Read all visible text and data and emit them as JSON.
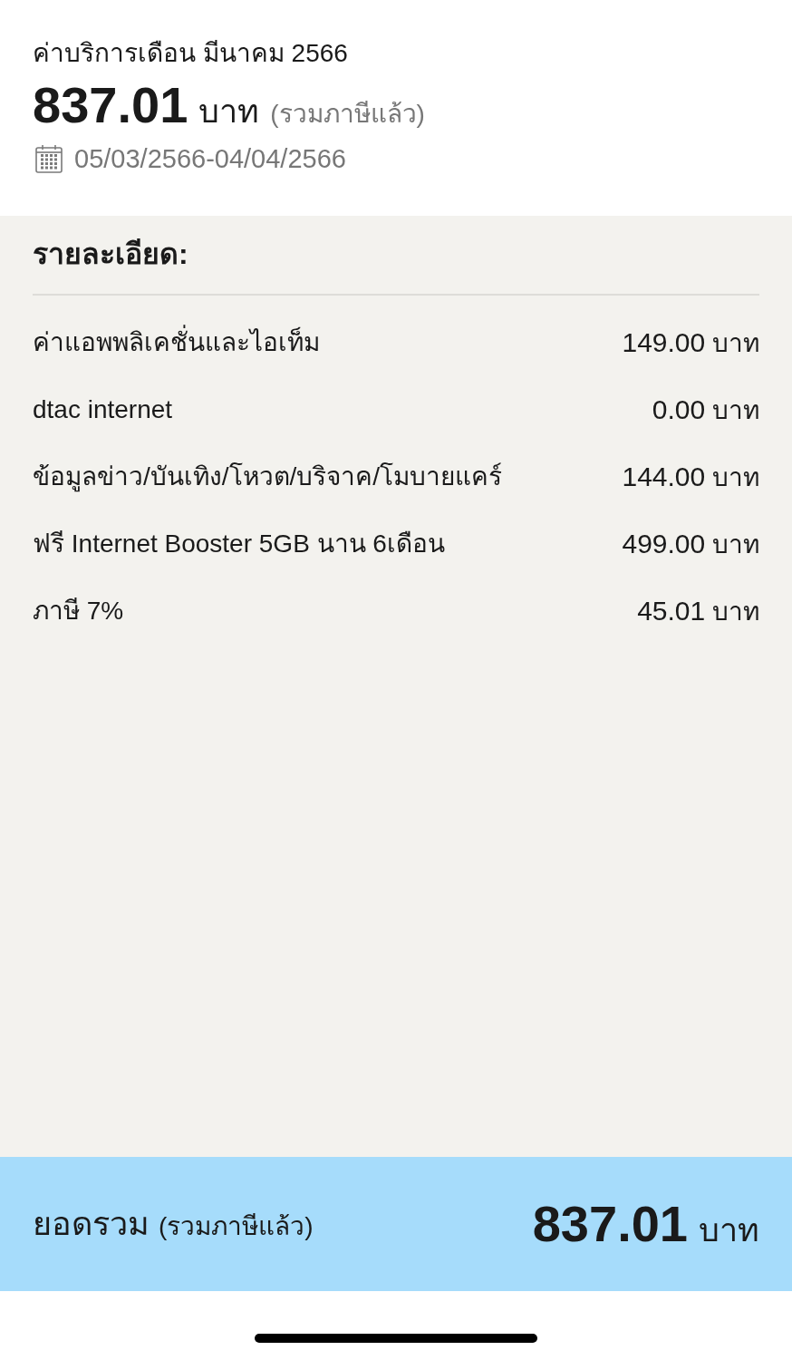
{
  "header": {
    "title": "ค่าบริการเดือน มีนาคม 2566",
    "amount": "837.01",
    "currency": "บาท",
    "tax_note": "(รวมภาษีแล้ว)",
    "period": "05/03/2566-04/04/2566"
  },
  "details": {
    "heading": "รายละเอียด:",
    "items": [
      {
        "label": "ค่าแอพพลิเคชั่นและไอเท็ม",
        "amount": "149.00",
        "currency": "บาท"
      },
      {
        "label": "dtac internet",
        "amount": "0.00",
        "currency": "บาท"
      },
      {
        "label": "ข้อมูลข่าว/บันเทิง/โหวต/บริจาค/โมบายแคร์",
        "amount": "144.00",
        "currency": "บาท"
      },
      {
        "label": "ฟรี Internet Booster 5GB นาน 6เดือน",
        "amount": "499.00",
        "currency": "บาท"
      },
      {
        "label": "ภาษี 7%",
        "amount": "45.01",
        "currency": "บาท"
      }
    ]
  },
  "total": {
    "label": "ยอดรวม",
    "tax_note": "(รวมภาษีแล้ว)",
    "amount": "837.01",
    "currency": "บาท"
  }
}
